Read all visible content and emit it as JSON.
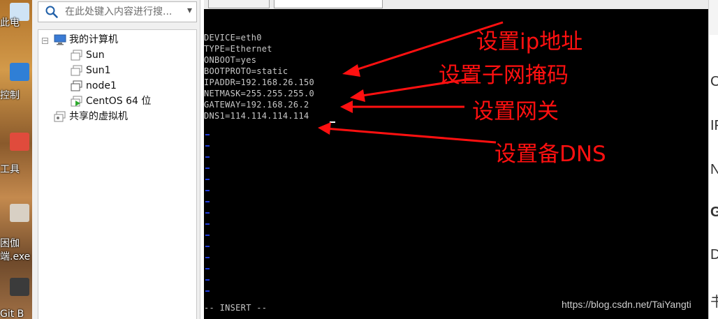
{
  "desktop": {
    "items": [
      {
        "label": "此电",
        "icon": "this-pc-icon"
      },
      {
        "label": "控制",
        "icon": "control-panel-icon"
      },
      {
        "label": "工具",
        "icon": "toolbox-icon"
      },
      {
        "label": "困伽",
        "icon": "shortcut-icon"
      },
      {
        "label": "端.exe",
        "icon": "exe-icon"
      },
      {
        "label": "Git B",
        "icon": "git-bash-icon"
      }
    ]
  },
  "library": {
    "search_placeholder": "在此处键入内容进行搜...",
    "tree": {
      "root_label": "我的计算机",
      "vms": [
        {
          "label": "Sun",
          "icon": "vm-icon"
        },
        {
          "label": "Sun1",
          "icon": "vm-icon"
        },
        {
          "label": "node1",
          "icon": "vm-icon"
        },
        {
          "label": "CentOS 64 位",
          "icon": "vm-running-icon"
        }
      ],
      "shared_label": "共享的虚拟机"
    }
  },
  "terminal": {
    "lines": [
      "DEVICE=eth0",
      "TYPE=Ethernet",
      "ONBOOT=yes",
      "BOOTPROTO=static",
      "IPADDR=192.168.26.150",
      "NETMASK=255.255.255.0",
      "GATEWAY=192.168.26.2",
      "DNS1=114.114.114.114"
    ],
    "mode": "-- INSERT --",
    "text_color": "#c8c8c8",
    "tilde_color": "#1e3ad6"
  },
  "annotations": {
    "color": "#ff1010",
    "set_ip": "设置ip地址",
    "set_netmask": "设置子网掩码",
    "set_gateway": "设置网关",
    "set_dns": "设置备DNS"
  },
  "watermark": "https://blog.csdn.net/TaiYangti",
  "right_panel": {
    "chars": [
      "C",
      "IF",
      "N",
      "G",
      "D",
      "书"
    ]
  }
}
